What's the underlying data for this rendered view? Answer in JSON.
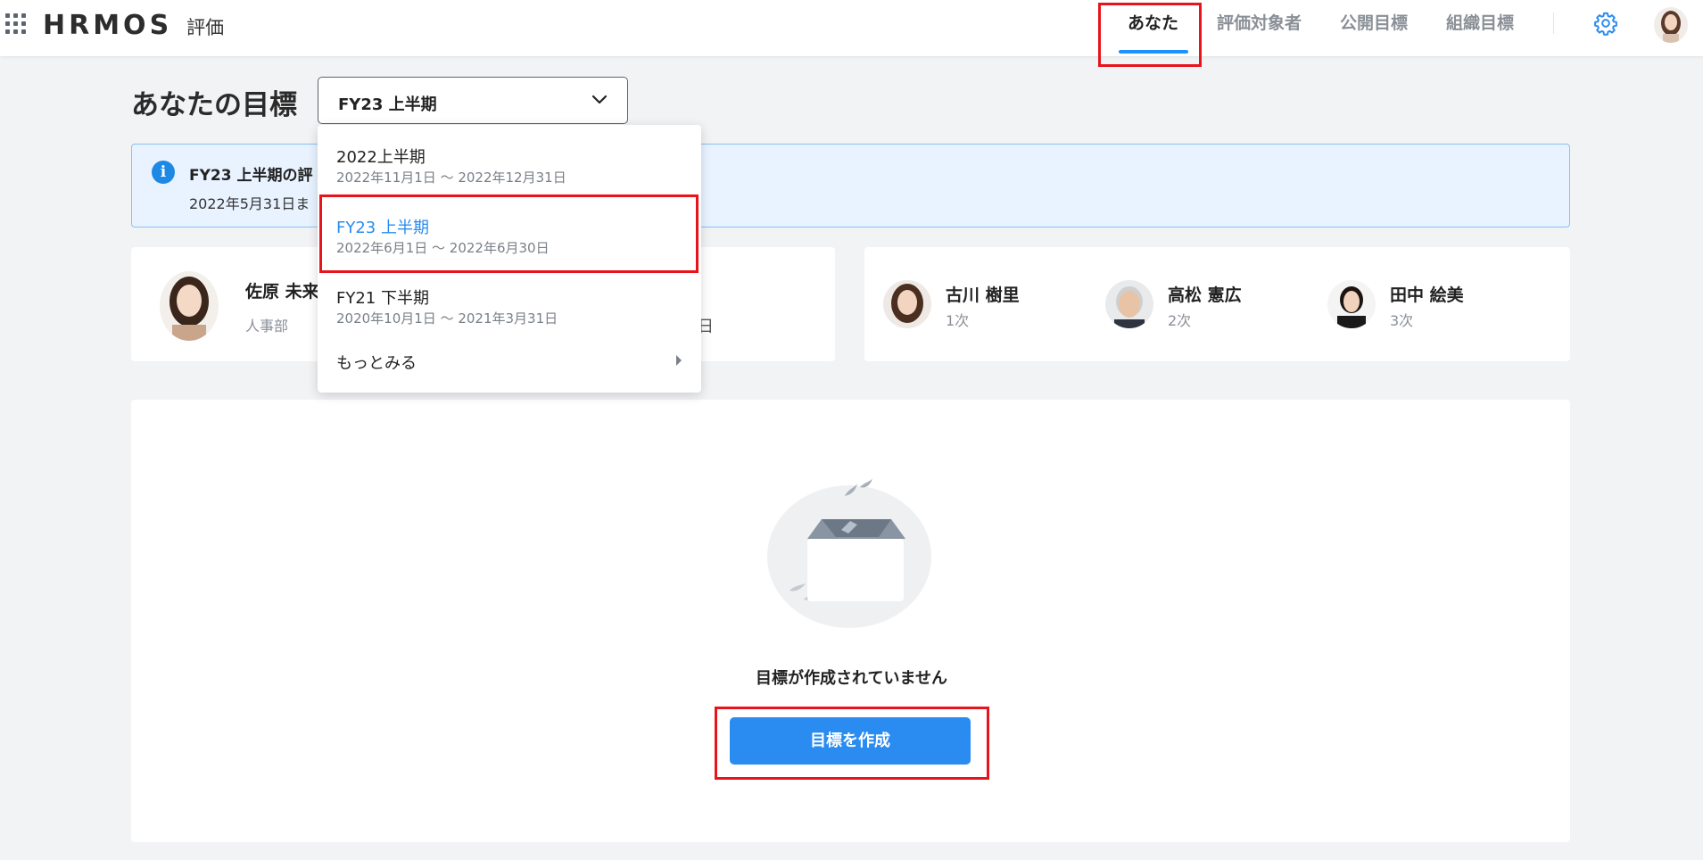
{
  "header": {
    "logo": "HRMOS",
    "product": "評価",
    "nav": [
      {
        "label": "あなた",
        "active": true
      },
      {
        "label": "評価対象者",
        "active": false
      },
      {
        "label": "公開目標",
        "active": false
      },
      {
        "label": "組織目標",
        "active": false
      }
    ]
  },
  "page": {
    "title": "あなたの目標",
    "period_select": {
      "value": "FY23 上半期"
    }
  },
  "dropdown": {
    "items": [
      {
        "label": "2022上半期",
        "range": "2022年11月1日 〜 2022年12月31日",
        "selected": false
      },
      {
        "label": "FY23 上半期",
        "range": "2022年6月1日 〜 2022年6月30日",
        "selected": true
      },
      {
        "label": "FY21 下半期",
        "range": "2020年10月1日 〜 2021年3月31日",
        "selected": false
      }
    ],
    "more_label": "もっとみる"
  },
  "info_banner": {
    "title": "FY23 上半期の評",
    "subtitle": "2022年5月31日ま"
  },
  "profile": {
    "name": "佐原 未来",
    "department": "人事部",
    "fragment": "日"
  },
  "evaluators": [
    {
      "name": "古川 樹里",
      "stage": "1次"
    },
    {
      "name": "高松 憲広",
      "stage": "2次"
    },
    {
      "name": "田中 絵美",
      "stage": "3次"
    }
  ],
  "empty_state": {
    "message": "目標が作成されていません",
    "button_label": "目標を作成"
  },
  "colors": {
    "accent": "#2a8cf0",
    "highlight": "#e8141c",
    "banner_bg": "#e8f3ff"
  }
}
